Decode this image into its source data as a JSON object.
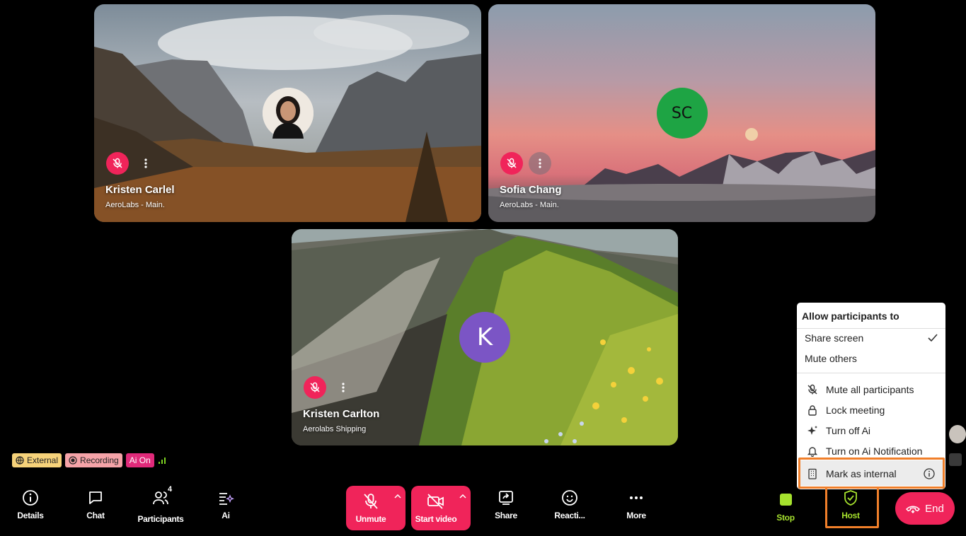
{
  "participants": [
    {
      "name": "Kristen Carlel",
      "org": "AeroLabs - Main."
    },
    {
      "name": "Sofia Chang",
      "org": "AeroLabs - Main.",
      "initials": "SC"
    },
    {
      "name": "Kristen Carlton",
      "org": "Aerolabs Shipping",
      "initials": "K"
    }
  ],
  "status": {
    "external": "External",
    "recording": "Recording",
    "ai": "Ai On"
  },
  "toolbar": {
    "details": "Details",
    "chat": "Chat",
    "participants": "Participants",
    "participants_count": "4",
    "ai": "Ai",
    "unmute": "Unmute",
    "start_video": "Start video",
    "share": "Share",
    "reactions": "Reacti...",
    "more": "More",
    "stop": "Stop",
    "host": "Host",
    "end": "End"
  },
  "host_menu": {
    "heading": "Allow participants to",
    "share_screen": "Share screen",
    "mute_others": "Mute others",
    "mute_all": "Mute all participants",
    "lock": "Lock meeting",
    "turn_off_ai": "Turn off Ai",
    "ai_notification": "Turn on Ai Notification",
    "mark_internal": "Mark as internal"
  },
  "colors": {
    "accent": "#f0245a",
    "highlight": "#f07f2a",
    "host_green": "#a6e22e"
  }
}
